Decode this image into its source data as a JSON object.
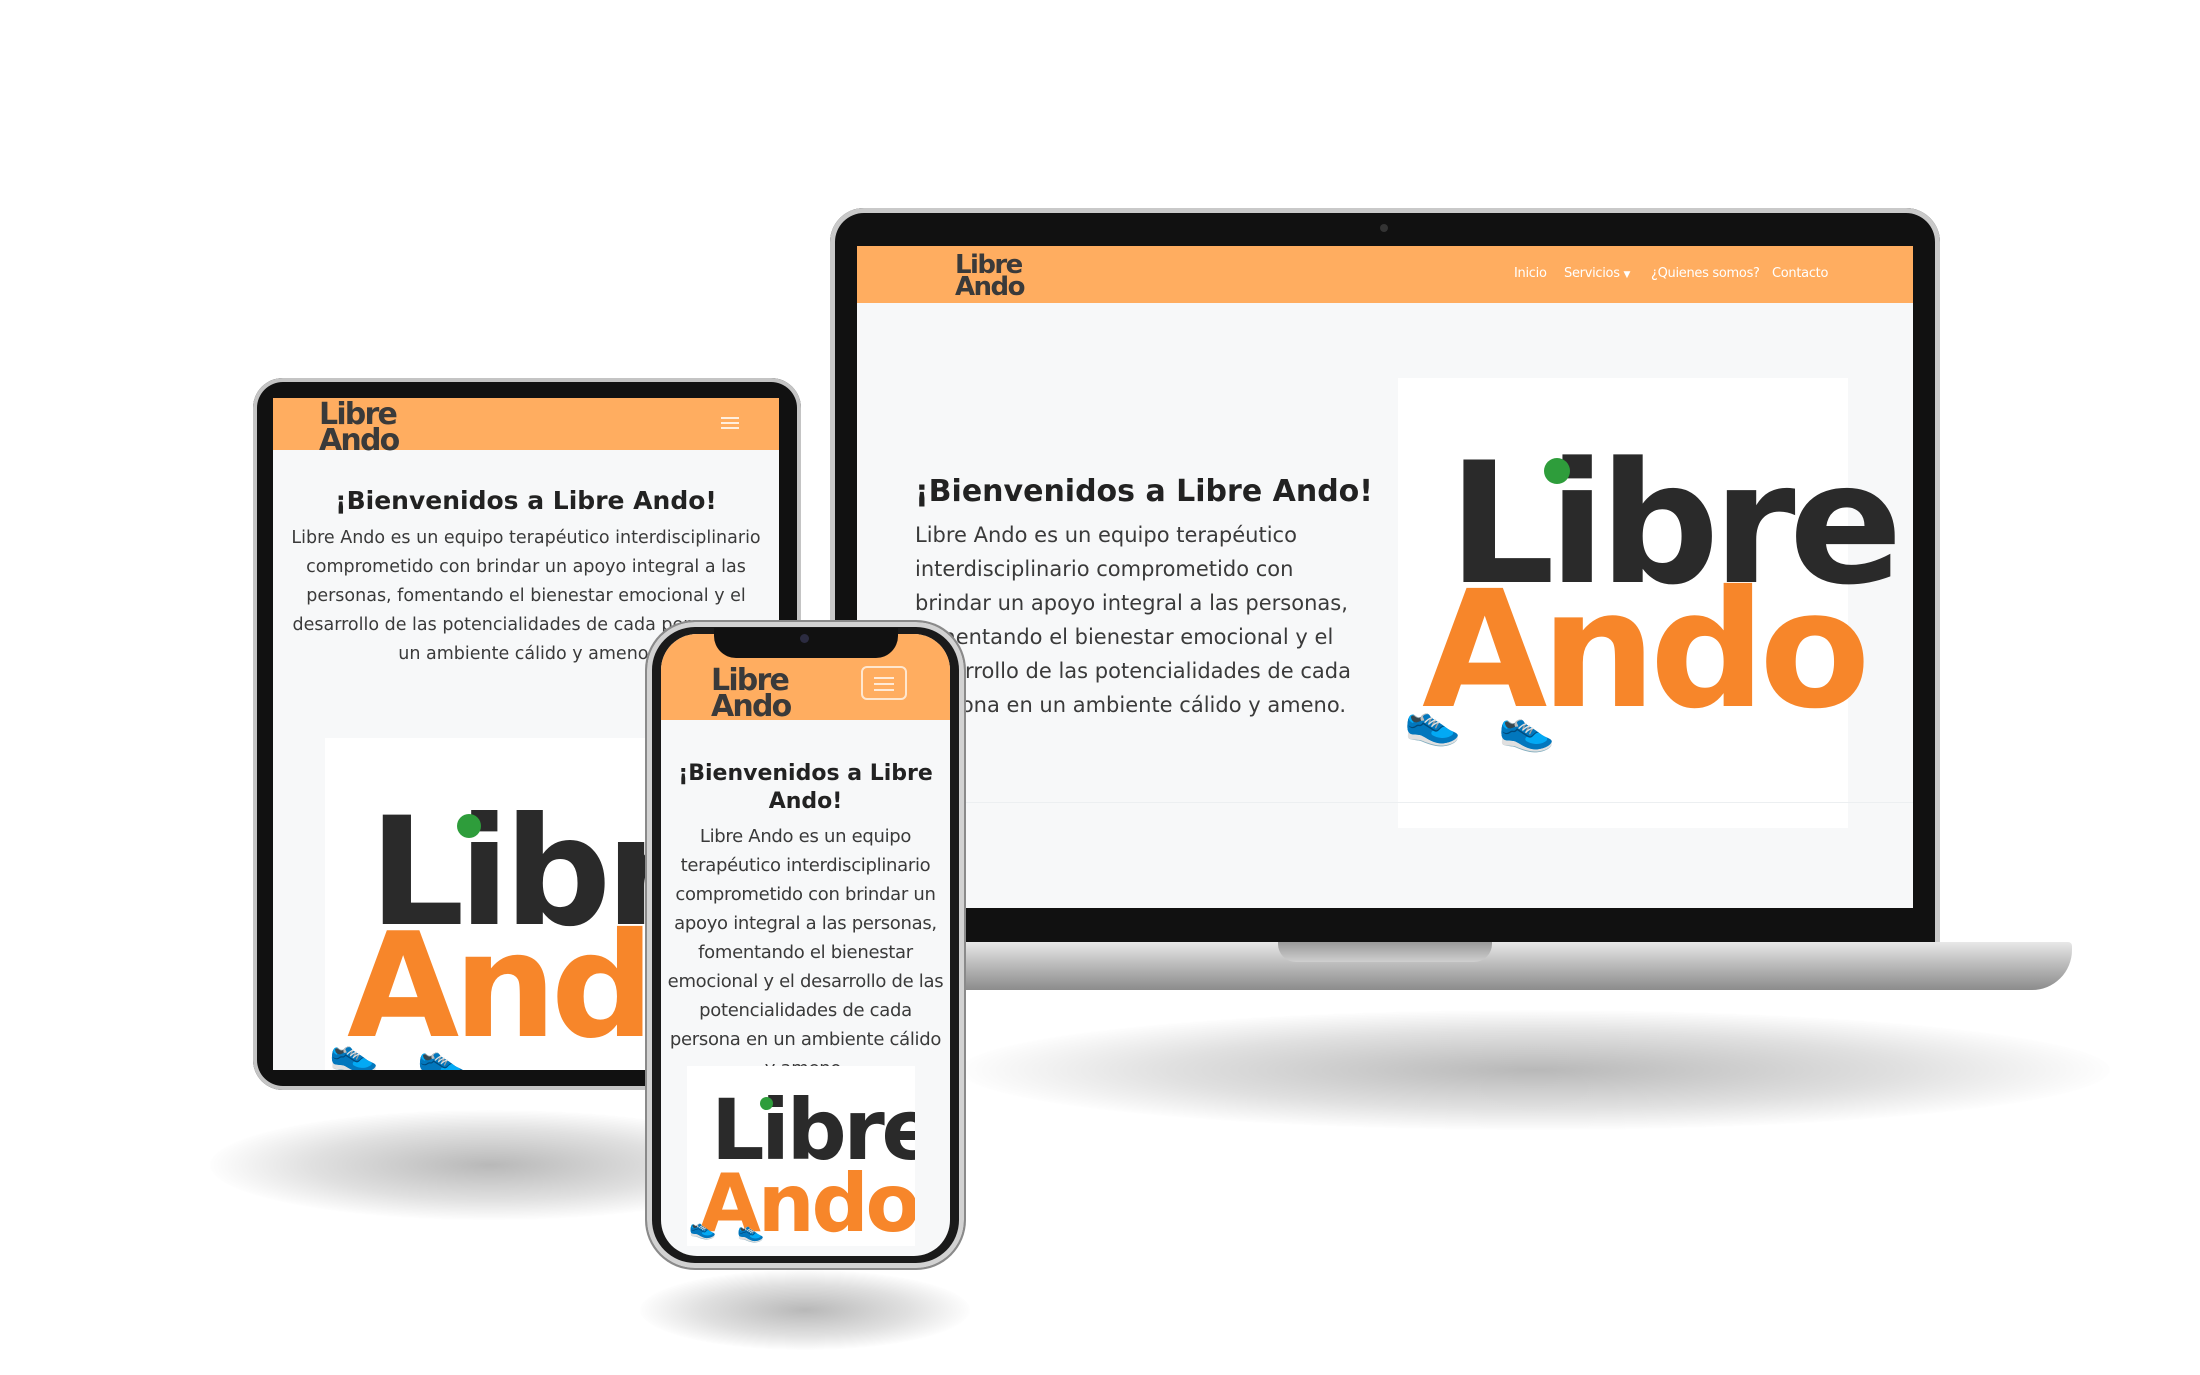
{
  "brand": {
    "logo_line1": "Libre",
    "logo_line2": "Ando",
    "accent_color": "#ffad60",
    "logo_orange": "#f7862a",
    "logo_green": "#2e9d3b"
  },
  "nav": {
    "items": [
      {
        "label": "Inicio"
      },
      {
        "label": "Servicios"
      },
      {
        "label": "¿Quienes somos?"
      },
      {
        "label": "Contacto"
      }
    ],
    "dropdown_icon": "caret-down-icon",
    "menu_icon": "hamburger-menu-icon"
  },
  "hero": {
    "title": "¡Bienvenidos a Libre Ando!",
    "text": "Libre Ando es un equipo terapéutico interdisciplinario comprometido con brindar un apoyo integral a las personas, fomentando el bienestar emocional y el desarrollo de las potencialidades de cada persona en un ambiente cálido y ameno."
  },
  "mockups": [
    "laptop",
    "tablet",
    "phone"
  ]
}
